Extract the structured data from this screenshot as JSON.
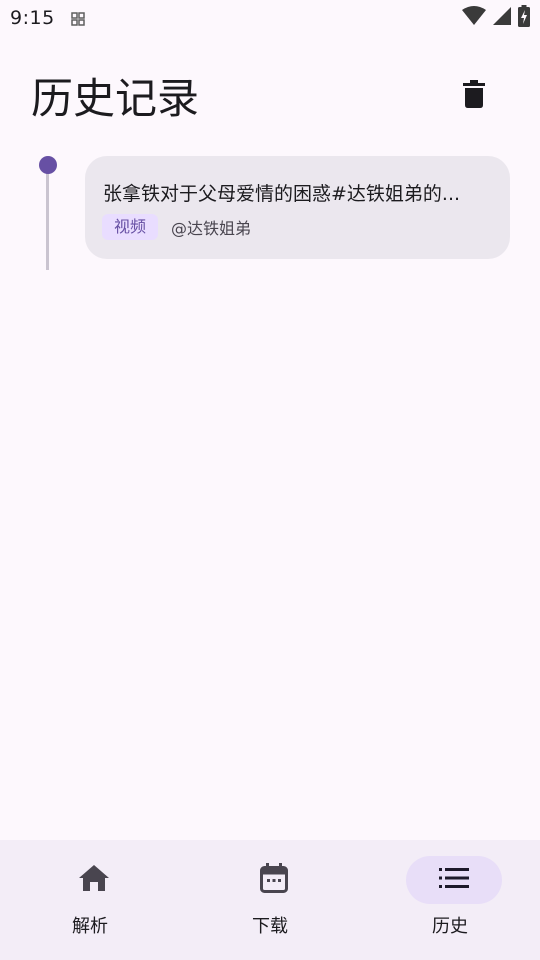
{
  "status_bar": {
    "time": "9:15",
    "icons": [
      "app-notification-icon",
      "wifi-icon",
      "cell-signal-icon",
      "battery-charging-icon"
    ]
  },
  "header": {
    "title": "历史记录",
    "delete_icon": "trash-icon"
  },
  "history": [
    {
      "title": "张拿铁对于父母爱情的困惑#达铁姐弟的...",
      "type": "视频",
      "author": "@达铁姐弟"
    }
  ],
  "bottom_nav": {
    "items": [
      {
        "label": "解析",
        "icon": "home-icon",
        "active": false
      },
      {
        "label": "下载",
        "icon": "calendar-icon",
        "active": false
      },
      {
        "label": "历史",
        "icon": "list-icon",
        "active": true
      }
    ]
  },
  "colors": {
    "accent": "#6750a4",
    "chip_bg": "#e9ddff",
    "card_bg": "#ebe7ee",
    "nav_bg": "#f3edf7",
    "active_indicator": "#e8def8",
    "background": "#fdf8fd"
  }
}
